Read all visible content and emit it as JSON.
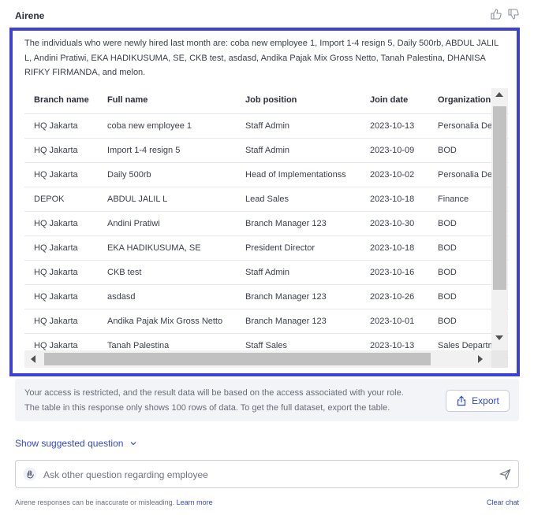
{
  "header": {
    "title": "Airene"
  },
  "response": {
    "summary": "The individuals who were newly hired last month are: coba new employee 1, Import 1-4 resign 5, Daily 500rb, ABDUL JALIL L, Andini Pratiwi, EKA HADIKUSUMA, SE, CKB test, asdasd, Andika Pajak Mix Gross Netto, Tanah Palestina, DHANISA RIFKY FIRMANDA, and melon.",
    "table": {
      "columns": [
        "Branch name",
        "Full name",
        "Job position",
        "Join date",
        "Organization"
      ],
      "rows": [
        [
          "HQ Jakarta",
          "coba new employee 1",
          "Staff Admin",
          "2023-10-13",
          "Personalia Dept"
        ],
        [
          "HQ Jakarta",
          "Import 1-4 resign 5",
          "Staff Admin",
          "2023-10-09",
          "BOD"
        ],
        [
          "HQ Jakarta",
          "Daily 500rb",
          "Head of Implementationss",
          "2023-10-02",
          "Personalia Dept"
        ],
        [
          "DEPOK",
          "ABDUL JALIL L",
          "Lead Sales",
          "2023-10-18",
          "Finance"
        ],
        [
          "HQ Jakarta",
          "Andini Pratiwi",
          "Branch Manager 123",
          "2023-10-30",
          "BOD"
        ],
        [
          "HQ Jakarta",
          "EKA HADIKUSUMA, SE",
          "President Director",
          "2023-10-18",
          "BOD"
        ],
        [
          "HQ Jakarta",
          "CKB test",
          "Staff Admin",
          "2023-10-16",
          "BOD"
        ],
        [
          "HQ Jakarta",
          "asdasd",
          "Branch Manager 123",
          "2023-10-26",
          "BOD"
        ],
        [
          "HQ Jakarta",
          "Andika Pajak Mix Gross Netto",
          "Branch Manager 123",
          "2023-10-01",
          "BOD"
        ],
        [
          "HQ Jakarta",
          "Tanah Palestina",
          "Staff Sales",
          "2023-10-13",
          "Sales Department"
        ]
      ]
    }
  },
  "notice": {
    "line1": "Your access is restricted, and the result data will be based on the access associated with your role.",
    "line2": "The table in this response only shows 100 rows of data. To get the full dataset, export the table.",
    "export_label": "Export"
  },
  "suggest_label": "Show suggested question",
  "input": {
    "placeholder": "Ask other question regarding employee"
  },
  "footer": {
    "disclaimer": "Airene responses can be inaccurate or misleading.",
    "learn_more": "Learn more",
    "clear_chat": "Clear chat"
  },
  "colors": {
    "accent": "#3d42d6",
    "link": "#3548c9"
  }
}
